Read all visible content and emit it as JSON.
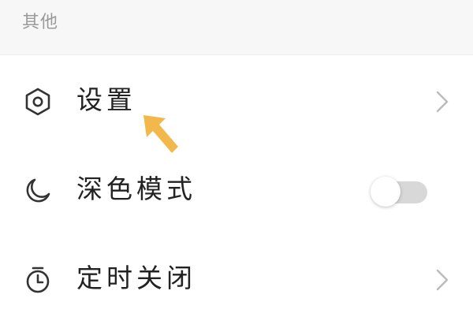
{
  "section": {
    "title": "其他"
  },
  "items": [
    {
      "label": "设置",
      "icon": "settings-hexagon-icon",
      "trailing": "chevron-right-icon"
    },
    {
      "label": "深色模式",
      "icon": "moon-icon",
      "trailing": "toggle-switch",
      "toggle_on": false
    },
    {
      "label": "定时关闭",
      "icon": "timer-icon",
      "trailing": "chevron-right-icon"
    }
  ],
  "annotation": {
    "icon": "pointer-arrow-icon",
    "color": "#f2b84b"
  },
  "colors": {
    "section_background": "#f7f7f7",
    "section_title": "#9a9a9a",
    "item_text": "#222222",
    "icon_stroke": "#333333",
    "chevron": "#bbbbbb",
    "toggle_track": "#d8d8d8"
  }
}
